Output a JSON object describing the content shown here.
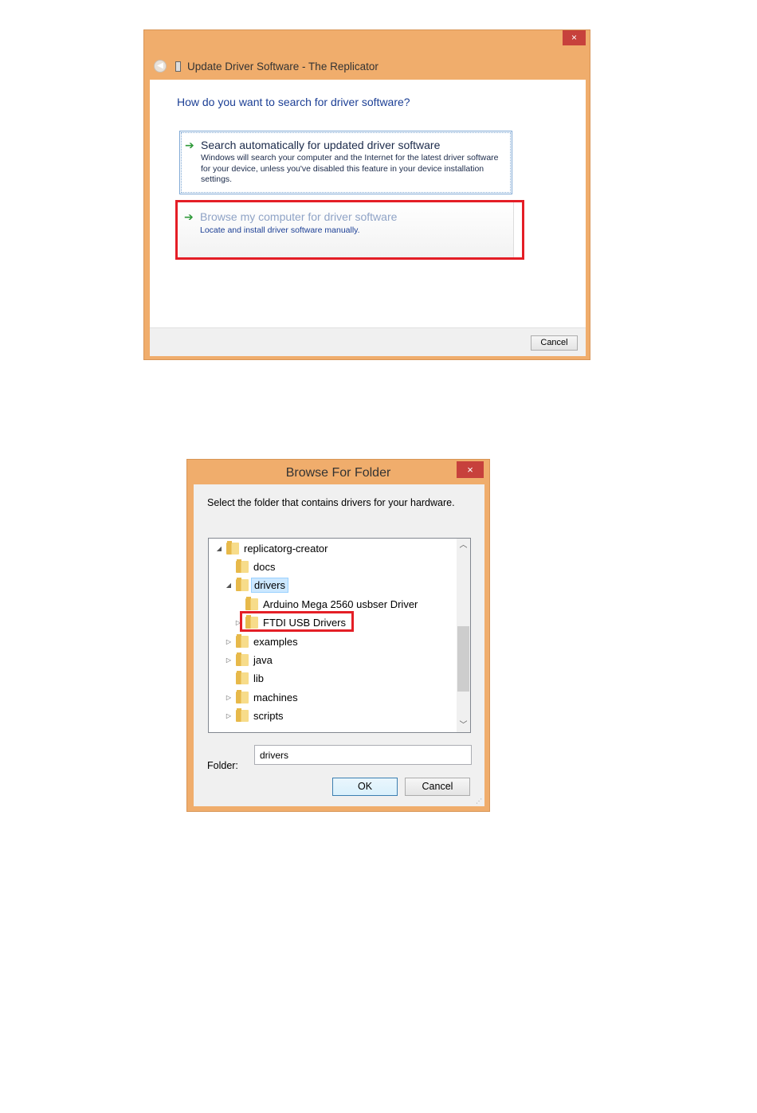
{
  "dialog1": {
    "window_title": "Update Driver Software - The Replicator",
    "close_glyph": "×",
    "question": "How do you want to search for driver software?",
    "option_auto": {
      "title": "Search automatically for updated driver software",
      "description": "Windows will search your computer and the Internet for the latest driver software for your device, unless you've disabled this feature in your device installation settings."
    },
    "option_browse": {
      "title": "Browse my computer for driver software",
      "description": "Locate and install driver software manually."
    },
    "cancel_label": "Cancel",
    "highlight_color": "#e41e26"
  },
  "dialog2": {
    "window_title": "Browse For Folder",
    "close_glyph": "×",
    "instruction": "Select the folder that contains drivers for your hardware.",
    "tree": [
      {
        "label": "replicatorg-creator",
        "twisty": "◢"
      },
      {
        "label": "docs",
        "twisty": ""
      },
      {
        "label": "drivers",
        "twisty": "◢"
      },
      {
        "label": "Arduino Mega 2560 usbser Driver",
        "twisty": ""
      },
      {
        "label": "FTDI USB Drivers",
        "twisty": "▷"
      },
      {
        "label": "examples",
        "twisty": "▷"
      },
      {
        "label": "java",
        "twisty": "▷"
      },
      {
        "label": "lib",
        "twisty": ""
      },
      {
        "label": "machines",
        "twisty": "▷"
      },
      {
        "label": "scripts",
        "twisty": "▷"
      }
    ],
    "folder_label": "Folder:",
    "folder_value": "drivers",
    "ok_label": "OK",
    "cancel_label": "Cancel",
    "accent_color": "#f0ad6c"
  }
}
